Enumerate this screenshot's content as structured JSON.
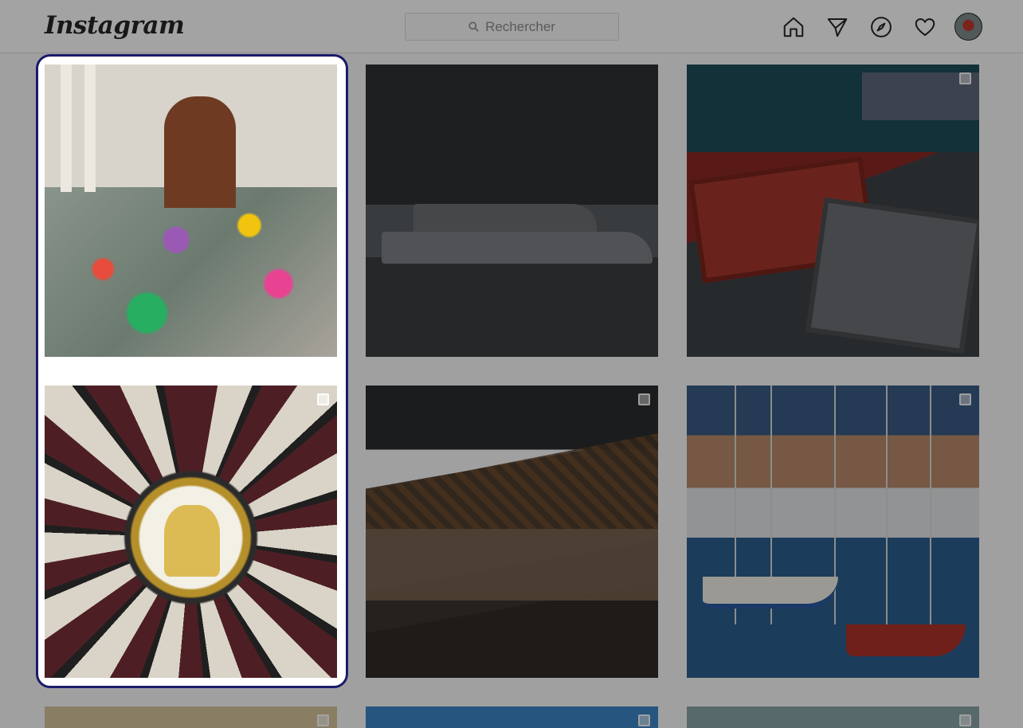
{
  "header": {
    "logo_text": "Instagram",
    "search_placeholder": "Rechercher",
    "icons": [
      "home-icon",
      "direct-message-icon",
      "explore-compass-icon",
      "activity-heart-icon"
    ],
    "avatar_label": "profile-avatar"
  },
  "grid": {
    "tiles": [
      {
        "name": "post-flowers-memorial",
        "multi": false
      },
      {
        "name": "post-yacht-harbor",
        "multi": false
      },
      {
        "name": "post-fish-market",
        "multi": true
      },
      {
        "name": "post-stained-glass",
        "multi": true
      },
      {
        "name": "post-hospices-de-beaune",
        "multi": true
      },
      {
        "name": "post-sailboats-harbor",
        "multi": true
      },
      {
        "name": "post-row3-left",
        "multi": true
      },
      {
        "name": "post-row3-middle",
        "multi": true
      },
      {
        "name": "post-row3-right",
        "multi": true
      }
    ]
  },
  "colors": {
    "focus_border": "#1b1a6b",
    "overlay": "rgba(0,0,0,0.36)"
  }
}
